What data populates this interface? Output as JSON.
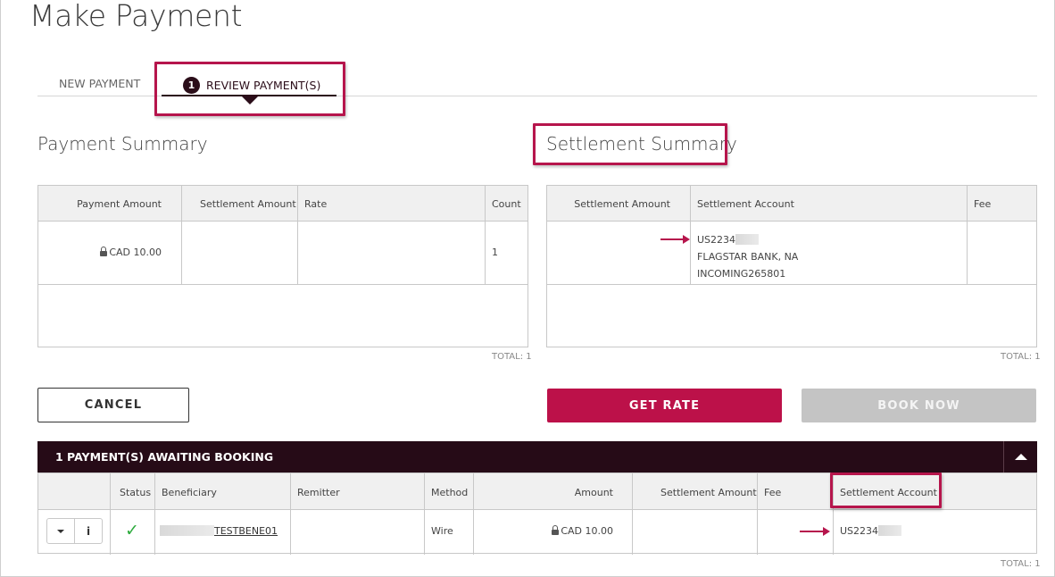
{
  "page": {
    "title": "Make Payment"
  },
  "tabs": {
    "new": "NEW PAYMENT",
    "review_badge": "1",
    "review": "REVIEW PAYMENT(S)"
  },
  "payment_summary": {
    "title": "Payment Summary",
    "headers": [
      "Payment Amount",
      "Settlement Amount",
      "Rate",
      "Count"
    ],
    "row": {
      "payment_amount": "CAD 10.00",
      "settlement_amount": "",
      "rate": "",
      "count": "1"
    },
    "total": "TOTAL: 1"
  },
  "settlement_summary": {
    "title": "Settlement Summary",
    "headers": [
      "Settlement Amount",
      "Settlement Account",
      "Fee"
    ],
    "row": {
      "account_line1": "US2234",
      "account_line2": "FLAGSTAR BANK, NA",
      "account_line3": "INCOMING265801",
      "fee": ""
    },
    "total": "TOTAL: 1"
  },
  "buttons": {
    "cancel": "CANCEL",
    "get_rate": "GET RATE",
    "book_now": "BOOK NOW"
  },
  "awaiting": {
    "title": "1 PAYMENT(S) AWAITING BOOKING",
    "headers": [
      "Status",
      "Beneficiary",
      "Remitter",
      "Method",
      "Amount",
      "Settlement Amount",
      "Fee",
      "Settlement Account"
    ],
    "row": {
      "beneficiary": "TESTBENE01",
      "remitter": "",
      "method": "Wire",
      "amount": "CAD 10.00",
      "settlement_amount": "",
      "fee": "",
      "settlement_account": "US2234"
    },
    "info_label": "i",
    "total": "TOTAL: 1"
  },
  "colors": {
    "accent": "#bc1149",
    "dark": "#260b17",
    "disabled": "#c4c4c4",
    "check": "#2eab3e"
  }
}
